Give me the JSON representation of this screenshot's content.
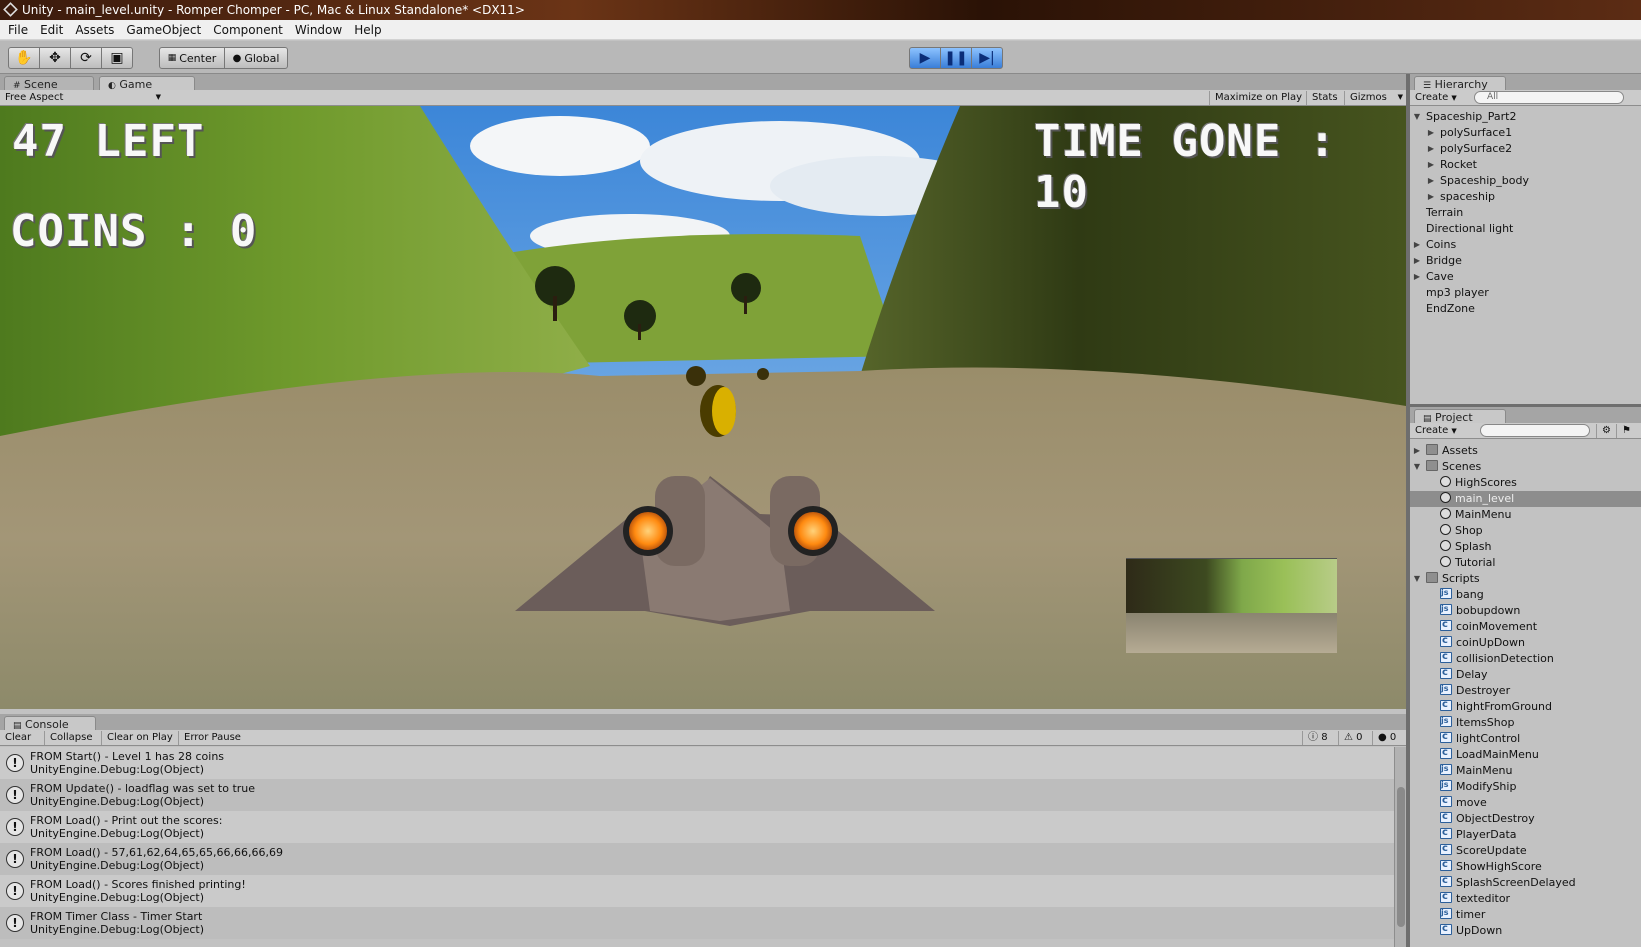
{
  "window": {
    "title": "Unity - main_level.unity - Romper Chomper - PC, Mac & Linux Standalone* <DX11>"
  },
  "menu": [
    "File",
    "Edit",
    "Assets",
    "GameObject",
    "Component",
    "Window",
    "Help"
  ],
  "toolbar": {
    "pivot_label": "Center",
    "space_label": "Global"
  },
  "scene_tabs": {
    "scene": "Scene",
    "game": "Game"
  },
  "game_bar": {
    "aspect": "Free Aspect",
    "maximize": "Maximize on Play",
    "stats": "Stats",
    "gizmos": "Gizmos"
  },
  "hud": {
    "left": "47 LEFT",
    "coins": "COINS : 0",
    "time": "TIME GONE : 10"
  },
  "hierarchy": {
    "title": "Hierarchy",
    "create": "Create",
    "search_placeholder": "All",
    "items": [
      {
        "label": "Spaceship_Part2",
        "expanded": true,
        "depth": 0,
        "arrow": true
      },
      {
        "label": "polySurface1",
        "expanded": false,
        "depth": 1,
        "arrow": true
      },
      {
        "label": "polySurface2",
        "expanded": false,
        "depth": 1,
        "arrow": true
      },
      {
        "label": "Rocket",
        "expanded": false,
        "depth": 1,
        "arrow": true
      },
      {
        "label": "Spaceship_body",
        "expanded": false,
        "depth": 1,
        "arrow": true
      },
      {
        "label": "spaceship",
        "expanded": false,
        "depth": 1,
        "arrow": true
      },
      {
        "label": "Terrain",
        "depth": 0,
        "arrow": false
      },
      {
        "label": "Directional light",
        "depth": 0,
        "arrow": false
      },
      {
        "label": "Coins",
        "expanded": false,
        "depth": 0,
        "arrow": true
      },
      {
        "label": "Bridge",
        "expanded": false,
        "depth": 0,
        "arrow": true
      },
      {
        "label": "Cave",
        "expanded": false,
        "depth": 0,
        "arrow": true
      },
      {
        "label": "mp3 player",
        "depth": 0,
        "arrow": false
      },
      {
        "label": "EndZone",
        "depth": 0,
        "arrow": false
      }
    ]
  },
  "project": {
    "title": "Project",
    "create": "Create",
    "items": [
      {
        "label": "Assets",
        "type": "folder",
        "expanded": false,
        "depth": 0
      },
      {
        "label": "Scenes",
        "type": "folder",
        "expanded": true,
        "depth": 0
      },
      {
        "label": "HighScores",
        "type": "unity",
        "depth": 1
      },
      {
        "label": "main_level",
        "type": "unity",
        "depth": 1,
        "selected": true
      },
      {
        "label": "MainMenu",
        "type": "unity",
        "depth": 1
      },
      {
        "label": "Shop",
        "type": "unity",
        "depth": 1
      },
      {
        "label": "Splash",
        "type": "unity",
        "depth": 1
      },
      {
        "label": "Tutorial",
        "type": "unity",
        "depth": 1
      },
      {
        "label": "Scripts",
        "type": "folder",
        "expanded": true,
        "depth": 0
      },
      {
        "label": "bang",
        "type": "js",
        "depth": 1
      },
      {
        "label": "bobupdown",
        "type": "js",
        "depth": 1
      },
      {
        "label": "coinMovement",
        "type": "cs",
        "depth": 1
      },
      {
        "label": "coinUpDown",
        "type": "cs",
        "depth": 1
      },
      {
        "label": "collisionDetection",
        "type": "cs",
        "depth": 1
      },
      {
        "label": "Delay",
        "type": "cs",
        "depth": 1
      },
      {
        "label": "Destroyer",
        "type": "js",
        "depth": 1
      },
      {
        "label": "hightFromGround",
        "type": "cs",
        "depth": 1
      },
      {
        "label": "ItemsShop",
        "type": "js",
        "depth": 1
      },
      {
        "label": "lightControl",
        "type": "cs",
        "depth": 1
      },
      {
        "label": "LoadMainMenu",
        "type": "cs",
        "depth": 1
      },
      {
        "label": "MainMenu",
        "type": "js",
        "depth": 1
      },
      {
        "label": "ModifyShip",
        "type": "js",
        "depth": 1
      },
      {
        "label": "move",
        "type": "cs",
        "depth": 1
      },
      {
        "label": "ObjectDestroy",
        "type": "cs",
        "depth": 1
      },
      {
        "label": "PlayerData",
        "type": "cs",
        "depth": 1
      },
      {
        "label": "ScoreUpdate",
        "type": "cs",
        "depth": 1
      },
      {
        "label": "ShowHighScore",
        "type": "cs",
        "depth": 1
      },
      {
        "label": "SplashScreenDelayed",
        "type": "cs",
        "depth": 1
      },
      {
        "label": "texteditor",
        "type": "cs",
        "depth": 1
      },
      {
        "label": "timer",
        "type": "js",
        "depth": 1
      },
      {
        "label": "UpDown",
        "type": "cs",
        "depth": 1
      }
    ]
  },
  "console": {
    "title": "Console",
    "buttons": [
      "Clear",
      "Collapse",
      "Clear on Play",
      "Error Pause"
    ],
    "counts": {
      "logs": "8",
      "warnings": "0",
      "errors": "0"
    },
    "entries": [
      {
        "line1": "FROM Start() - Level 1 has 28 coins",
        "line2": "UnityEngine.Debug:Log(Object)"
      },
      {
        "line1": "FROM Update() - loadflag was set to true",
        "line2": "UnityEngine.Debug:Log(Object)"
      },
      {
        "line1": "FROM Load() - Print out the scores:",
        "line2": "UnityEngine.Debug:Log(Object)"
      },
      {
        "line1": "FROM Load() - 57,61,62,64,65,65,66,66,66,69",
        "line2": "UnityEngine.Debug:Log(Object)"
      },
      {
        "line1": "FROM Load() - Scores finished printing!",
        "line2": "UnityEngine.Debug:Log(Object)"
      },
      {
        "line1": "FROM Timer Class - Timer Start",
        "line2": "UnityEngine.Debug:Log(Object)"
      }
    ]
  }
}
